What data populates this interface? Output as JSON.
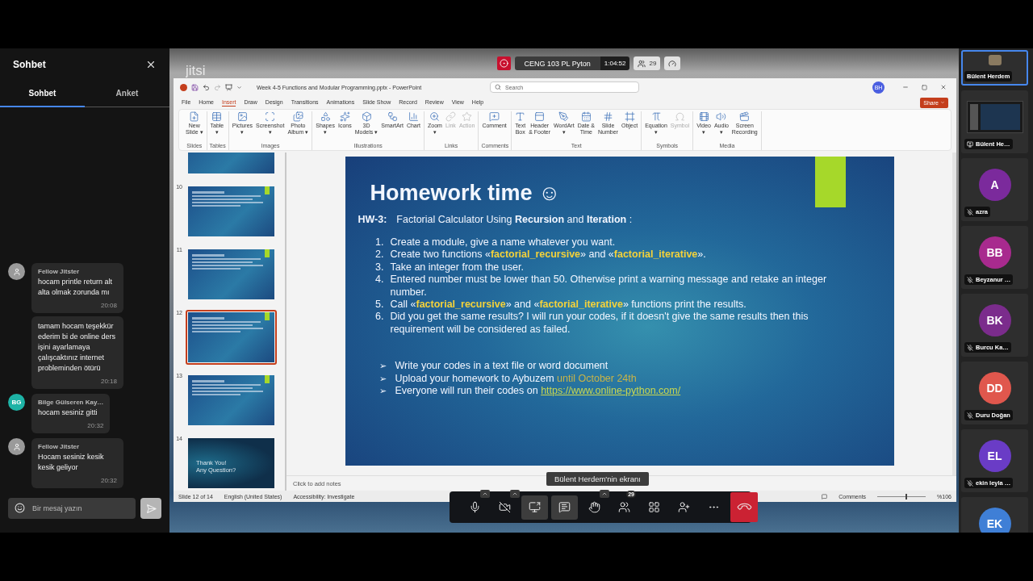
{
  "meeting": {
    "logo": "jitsi",
    "title": "CENG 103 PL Pyton",
    "timer": "1:04:52",
    "participant_count": "29"
  },
  "chat": {
    "title": "Sohbet",
    "tabs": [
      {
        "label": "Sohbet",
        "selected": true
      },
      {
        "label": "Anket",
        "selected": false
      }
    ],
    "groups": [
      {
        "sender": "Fellow Jitster",
        "kind": "generic",
        "messages": [
          {
            "text": "hocam printle return alt alta olmak zorunda mı",
            "time": "20:08"
          },
          {
            "text": "tamam hocam teşekkür ederim bi de online ders işini ayarlamaya çalışcaktınız internet probleminden ötürü",
            "time": "20:18"
          }
        ]
      },
      {
        "sender": "Bilge Gülseren Kay…",
        "kind": "initials",
        "initials": "BG",
        "color": "#1eb3a6",
        "messages": [
          {
            "text": "hocam sesiniz gitti",
            "time": "20:32"
          }
        ]
      },
      {
        "sender": "Fellow Jitster",
        "kind": "generic",
        "messages": [
          {
            "text": "Hocam sesiniz kesik kesik geliyor",
            "time": "20:32"
          }
        ]
      }
    ],
    "input": {
      "placeholder": "Bir mesaj yazın"
    }
  },
  "powerpoint": {
    "title": "Week 4-5 Functions and Modular Programming.pptx  -  PowerPoint",
    "search": {
      "placeholder": "Search"
    },
    "user_initials": "BH",
    "share": "Share",
    "menu": [
      {
        "label": "File",
        "selected": false
      },
      {
        "label": "Home",
        "selected": false
      },
      {
        "label": "Insert",
        "selected": true
      },
      {
        "label": "Draw",
        "selected": false
      },
      {
        "label": "Design",
        "selected": false
      },
      {
        "label": "Transitions",
        "selected": false
      },
      {
        "label": "Animations",
        "selected": false
      },
      {
        "label": "Slide Show",
        "selected": false
      },
      {
        "label": "Record",
        "selected": false
      },
      {
        "label": "Review",
        "selected": false
      },
      {
        "label": "View",
        "selected": false
      },
      {
        "label": "Help",
        "selected": false
      }
    ],
    "ribbon": [
      {
        "label": "Slides",
        "buttons": [
          {
            "label": "New\nSlide ▾",
            "disabled": false
          }
        ]
      },
      {
        "label": "Tables",
        "buttons": [
          {
            "label": "Table\n▾",
            "disabled": false
          }
        ]
      },
      {
        "label": "Images",
        "buttons": [
          {
            "label": "Pictures\n▾",
            "disabled": false
          },
          {
            "label": "Screenshot\n▾",
            "disabled": false
          },
          {
            "label": "Photo\nAlbum ▾",
            "disabled": false
          }
        ]
      },
      {
        "label": "Illustrations",
        "buttons": [
          {
            "label": "Shapes\n▾",
            "disabled": false
          },
          {
            "label": "Icons",
            "disabled": false
          },
          {
            "label": "3D\nModels ▾",
            "disabled": false
          },
          {
            "label": "SmartArt",
            "disabled": false
          },
          {
            "label": "Chart",
            "disabled": false
          }
        ]
      },
      {
        "label": "Links",
        "buttons": [
          {
            "label": "Zoom\n▾",
            "disabled": false
          },
          {
            "label": "Link",
            "disabled": true
          },
          {
            "label": "Action",
            "disabled": true
          }
        ]
      },
      {
        "label": "Comments",
        "buttons": [
          {
            "label": "Comment",
            "disabled": false
          }
        ]
      },
      {
        "label": "Text",
        "buttons": [
          {
            "label": "Text\nBox",
            "disabled": false
          },
          {
            "label": "Header\n& Footer",
            "disabled": false
          },
          {
            "label": "WordArt\n▾",
            "disabled": false
          },
          {
            "label": "Date &\nTime",
            "disabled": false
          },
          {
            "label": "Slide\nNumber",
            "disabled": false
          },
          {
            "label": "Object",
            "disabled": false
          }
        ]
      },
      {
        "label": "Symbols",
        "buttons": [
          {
            "label": "Equation\n▾",
            "disabled": false
          },
          {
            "label": "Symbol",
            "disabled": true
          }
        ]
      },
      {
        "label": "Media",
        "buttons": [
          {
            "label": "Video\n▾",
            "disabled": false
          },
          {
            "label": "Audio\n▾",
            "disabled": false
          },
          {
            "label": "Screen\nRecording",
            "disabled": false
          }
        ]
      }
    ],
    "thumbnails": [
      {
        "number": "10",
        "selected": false
      },
      {
        "number": "11",
        "selected": false
      },
      {
        "number": "12",
        "selected": true
      },
      {
        "number": "13",
        "selected": false
      },
      {
        "number": "14",
        "selected": false,
        "caption": "Thank You! Any Question?"
      }
    ],
    "slide": {
      "title": "Homework time ☺",
      "hw_label": "HW-3:",
      "hw_text": "Factorial Calculator Using **Recursion** and **Iteration** :",
      "items": [
        {
          "number": "1.",
          "parts": [
            {
              "kind": "plain",
              "text": "Create a module, give a name whatever you want."
            }
          ]
        },
        {
          "number": "2.",
          "parts": [
            {
              "kind": "plain",
              "text": "Create two functions «"
            },
            {
              "kind": "code",
              "text": "factorial_recursive"
            },
            {
              "kind": "plain",
              "text": "» and «"
            },
            {
              "kind": "code",
              "text": "factorial_iterative"
            },
            {
              "kind": "plain",
              "text": "»."
            }
          ]
        },
        {
          "number": "3.",
          "parts": [
            {
              "kind": "plain",
              "text": "Take an integer from the user."
            }
          ]
        },
        {
          "number": "4.",
          "parts": [
            {
              "kind": "plain",
              "text": "Entered number must be lower than 50. Otherwise print a warning message and retake an integer number."
            }
          ]
        },
        {
          "number": "5.",
          "parts": [
            {
              "kind": "plain",
              "text": "Call «"
            },
            {
              "kind": "code",
              "text": "factorial_recursive"
            },
            {
              "kind": "plain",
              "text": "» and «"
            },
            {
              "kind": "code",
              "text": "factorial_iterative"
            },
            {
              "kind": "plain",
              "text": "» functions print the results."
            }
          ]
        },
        {
          "number": "6.",
          "parts": [
            {
              "kind": "plain",
              "text": "Did you get the same results? I will run your codes, if it doesn't give the same results then this requirement will be considered as failed."
            }
          ]
        }
      ],
      "bullets": [
        {
          "marker": "➢",
          "parts": [
            {
              "kind": "plain",
              "text": "Write your codes in a text file or word document"
            }
          ]
        },
        {
          "marker": "➢",
          "parts": [
            {
              "kind": "plain",
              "text": "Upload your homework to Aybuzem "
            },
            {
              "kind": "date",
              "text": "until October 24th"
            }
          ]
        },
        {
          "marker": "➢",
          "parts": [
            {
              "kind": "plain",
              "text": "Everyone will run their codes on "
            },
            {
              "kind": "link",
              "text": "https://www.online-python.com/"
            }
          ]
        }
      ]
    },
    "notes_placeholder": "Click to add notes",
    "status_bar": {
      "slide": "Slide 12 of 14",
      "language": "English (United States)",
      "accessibility": "Accessibility: Investigate",
      "comments": "Comments",
      "zoom_slider": {
        "level": 0.6
      },
      "zoom": "%106"
    }
  },
  "screen_label": "Bülent Herdem'nin ekranı",
  "toolbar": [
    {
      "kind": "mic",
      "active": false,
      "caret": true
    },
    {
      "kind": "camera",
      "active": false,
      "caret": true
    },
    {
      "kind": "share",
      "active": true,
      "caret": false
    },
    {
      "kind": "chat",
      "active": true,
      "caret": false
    },
    {
      "kind": "hand",
      "active": false,
      "caret": true
    },
    {
      "kind": "participants",
      "active": false,
      "caret": false,
      "badge": "29"
    },
    {
      "kind": "tiles",
      "active": false,
      "caret": false
    },
    {
      "kind": "invite",
      "active": false,
      "caret": false
    },
    {
      "kind": "more",
      "active": false,
      "caret": false
    },
    {
      "kind": "hangup",
      "active": false,
      "caret": false
    }
  ],
  "filmstrip": [
    {
      "kind": "camera",
      "name": "Bülent Herdem",
      "selected": true,
      "muted": false
    },
    {
      "kind": "screen",
      "name": "Bülent He…",
      "selected": false,
      "muted": false
    },
    {
      "kind": "avatar",
      "name": "azra",
      "initials": "A",
      "color": "#7b2a9c",
      "selected": false,
      "muted": true
    },
    {
      "kind": "avatar",
      "name": "Beyzanur …",
      "initials": "BB",
      "color": "#a82a8e",
      "selected": false,
      "muted": true
    },
    {
      "kind": "avatar",
      "name": "Burcu Ka…",
      "initials": "BK",
      "color": "#7b2c8c",
      "selected": false,
      "muted": true
    },
    {
      "kind": "avatar",
      "name": "Duru Doğan",
      "initials": "DD",
      "color": "#e0574d",
      "selected": false,
      "muted": true
    },
    {
      "kind": "avatar",
      "name": "ekin leyla …",
      "initials": "EL",
      "color": "#6a3cc6",
      "selected": false,
      "muted": true
    },
    {
      "kind": "avatar",
      "initials": "EK",
      "color": "#3f7fd6",
      "selected": false
    }
  ]
}
